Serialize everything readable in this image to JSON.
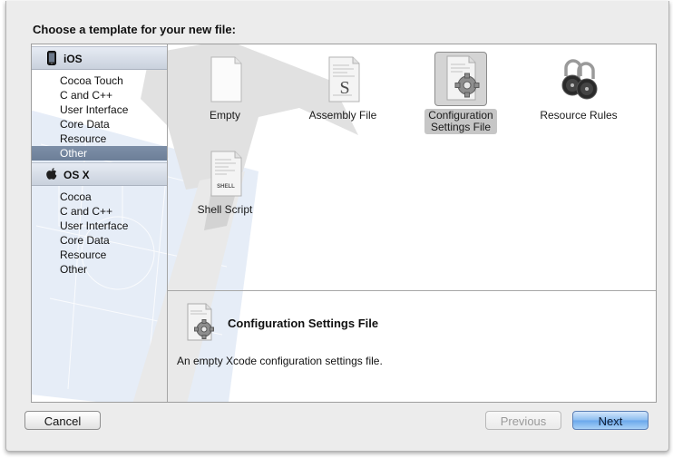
{
  "dialog": {
    "prompt": "Choose a template for your new file:"
  },
  "sidebar": {
    "groups": [
      {
        "name": "iOS",
        "icon": "iphone-icon",
        "items": [
          "Cocoa Touch",
          "C and C++",
          "User Interface",
          "Core Data",
          "Resource",
          "Other"
        ],
        "selected_index": 5
      },
      {
        "name": "OS X",
        "icon": "apple-logo-icon",
        "items": [
          "Cocoa",
          "C and C++",
          "User Interface",
          "Core Data",
          "Resource",
          "Other"
        ],
        "selected_index": null
      }
    ]
  },
  "templates": [
    {
      "label": "Empty",
      "icon": "blank-document-icon",
      "selected": false
    },
    {
      "label": "Assembly File",
      "icon": "assembly-file-icon",
      "selected": false
    },
    {
      "label": "Configuration\nSettings File",
      "icon": "configuration-settings-icon",
      "selected": true
    },
    {
      "label": "Resource Rules",
      "icon": "padlocks-icon",
      "selected": false
    },
    {
      "label": "Shell Script",
      "icon": "shell-script-icon",
      "selected": false
    }
  ],
  "document_glyphs": {
    "assembly": "S",
    "shell": "SHELL"
  },
  "description": {
    "title": "Configuration Settings File",
    "text": "An empty Xcode configuration settings file.",
    "icon": "configuration-settings-icon"
  },
  "buttons": {
    "cancel": "Cancel",
    "previous": "Previous",
    "next": "Next"
  },
  "colors": {
    "selection": "#7486a0",
    "default_button": "#6aa7ec"
  }
}
